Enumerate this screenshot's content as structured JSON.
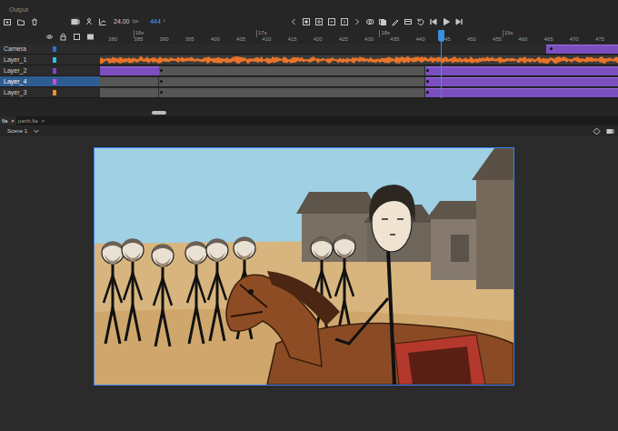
{
  "toolbar": {
    "output_label": "Output",
    "fps": "24.00",
    "fps_unit": "fps",
    "frame": "444",
    "frame_unit": "f"
  },
  "timeline": {
    "ruler_seconds": [
      "16s",
      "17s",
      "18s",
      "19s"
    ],
    "ruler_frames": [
      "380",
      "385",
      "390",
      "395",
      "400",
      "405",
      "410",
      "415",
      "420",
      "425",
      "430",
      "435",
      "440",
      "445",
      "450",
      "455",
      "460",
      "465",
      "470",
      "475"
    ],
    "playhead_frame": 444,
    "layers": [
      {
        "name": "Camera",
        "color": "#2f6fd6",
        "selected": false,
        "spans": [
          {
            "start": 464.5,
            "end": 481,
            "kind": "tween"
          }
        ],
        "keyframes": [
          465
        ]
      },
      {
        "name": "Layer_1",
        "color": "#27c4e8",
        "selected": false,
        "spans": [
          {
            "start": 377.5,
            "end": 481,
            "kind": "audio"
          }
        ],
        "keyframes": []
      },
      {
        "name": "Layer_2",
        "color": "#8b3fd6",
        "selected": false,
        "spans": [
          {
            "start": 377.5,
            "end": 389,
            "kind": "tween"
          },
          {
            "start": 389,
            "end": 441,
            "kind": "static"
          },
          {
            "start": 441,
            "end": 481,
            "kind": "tween"
          }
        ],
        "keyframes": [
          389,
          441
        ]
      },
      {
        "name": "Layer_4",
        "color": "#e040e0",
        "selected": true,
        "spans": [
          {
            "start": 377.5,
            "end": 389,
            "kind": "static"
          },
          {
            "start": 389,
            "end": 441,
            "kind": "static"
          },
          {
            "start": 441,
            "end": 481,
            "kind": "tween"
          }
        ],
        "keyframes": [
          389,
          441
        ]
      },
      {
        "name": "Layer_3",
        "color": "#f0902a",
        "selected": false,
        "spans": [
          {
            "start": 377.5,
            "end": 389,
            "kind": "static"
          },
          {
            "start": 389,
            "end": 441,
            "kind": "static"
          },
          {
            "start": 441,
            "end": 481,
            "kind": "tween"
          }
        ],
        "keyframes": [
          389,
          441
        ]
      }
    ]
  },
  "documents": {
    "tabs": [
      {
        "label": "fla",
        "close": "×",
        "selected": true
      },
      {
        "label": "parth.fla",
        "close": "×",
        "selected": false
      }
    ]
  },
  "scene": {
    "label": "Scene 1"
  }
}
